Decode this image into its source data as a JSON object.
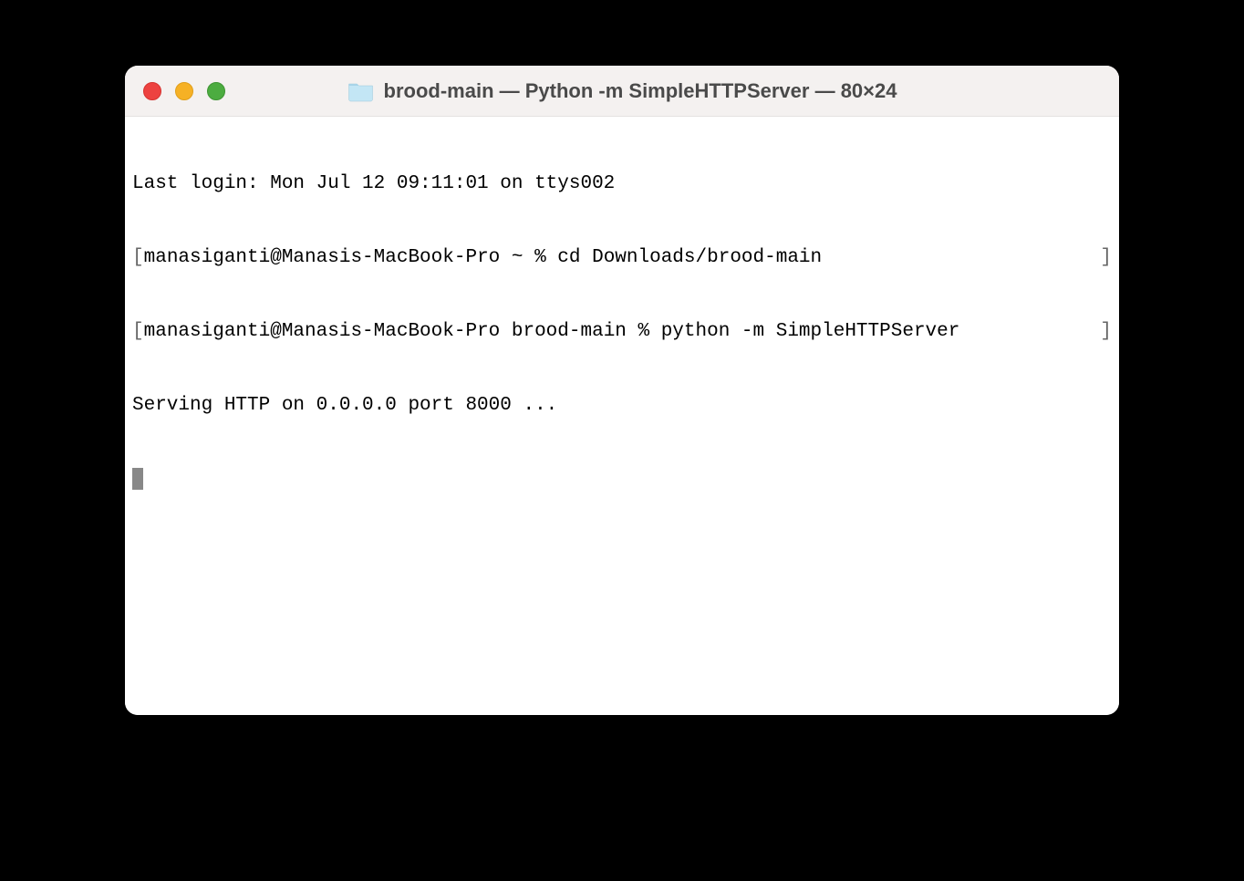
{
  "titlebar": {
    "title": "brood-main — Python -m SimpleHTTPServer — 80×24",
    "folder_icon_name": "folder-icon"
  },
  "traffic_lights": {
    "close_color": "#ed4240",
    "minimize_color": "#f6b125",
    "zoom_color": "#4cac40"
  },
  "terminal": {
    "lines": [
      {
        "type": "plain",
        "text": "Last login: Mon Jul 12 09:11:01 on ttys002"
      },
      {
        "type": "bracketed",
        "text": "manasiganti@Manasis-MacBook-Pro ~ % cd Downloads/brood-main"
      },
      {
        "type": "bracketed",
        "text": "manasiganti@Manasis-MacBook-Pro brood-main % python -m SimpleHTTPServer"
      },
      {
        "type": "plain",
        "text": "Serving HTTP on 0.0.0.0 port 8000 ..."
      }
    ]
  }
}
